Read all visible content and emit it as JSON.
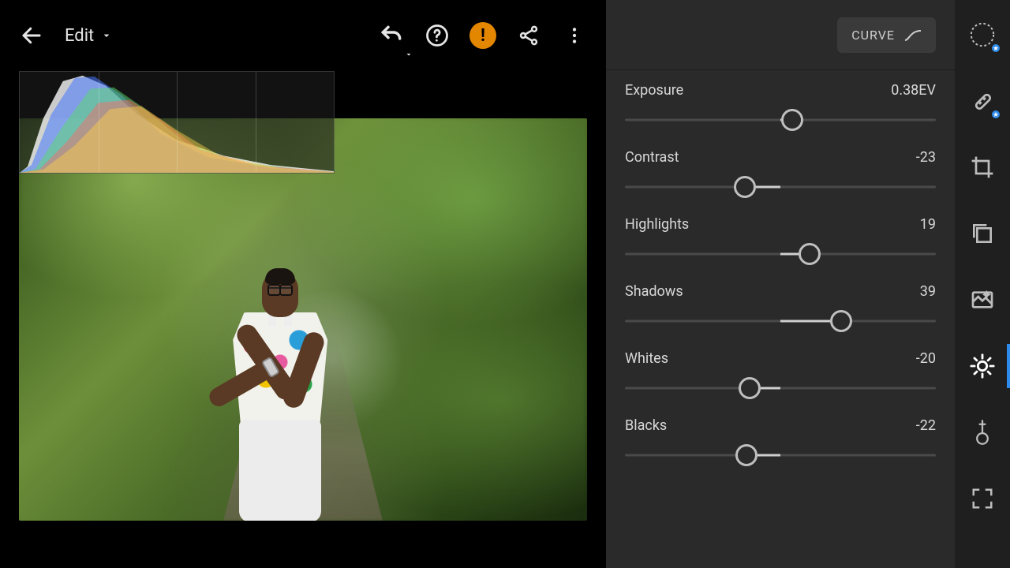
{
  "header": {
    "mode_label": "Edit",
    "curve_label": "CURVE"
  },
  "sliders": {
    "range_min": -100,
    "range_max": 100,
    "exposure": {
      "label": "Exposure",
      "value_display": "0.38EV",
      "value_norm": 0.076
    },
    "contrast": {
      "label": "Contrast",
      "value_display": "-23",
      "value_norm": -0.23
    },
    "highlights": {
      "label": "Highlights",
      "value_display": "19",
      "value_norm": 0.19
    },
    "shadows": {
      "label": "Shadows",
      "value_display": "39",
      "value_norm": 0.39
    },
    "whites": {
      "label": "Whites",
      "value_display": "-20",
      "value_norm": -0.2
    },
    "blacks": {
      "label": "Blacks",
      "value_display": "-22",
      "value_norm": -0.22
    }
  },
  "rail": {
    "items": [
      "lens-icon",
      "heal-icon",
      "crop-icon",
      "versions-icon",
      "presets-icon",
      "light-icon",
      "color-icon",
      "fullscreen-icon"
    ],
    "active": "light-icon"
  }
}
